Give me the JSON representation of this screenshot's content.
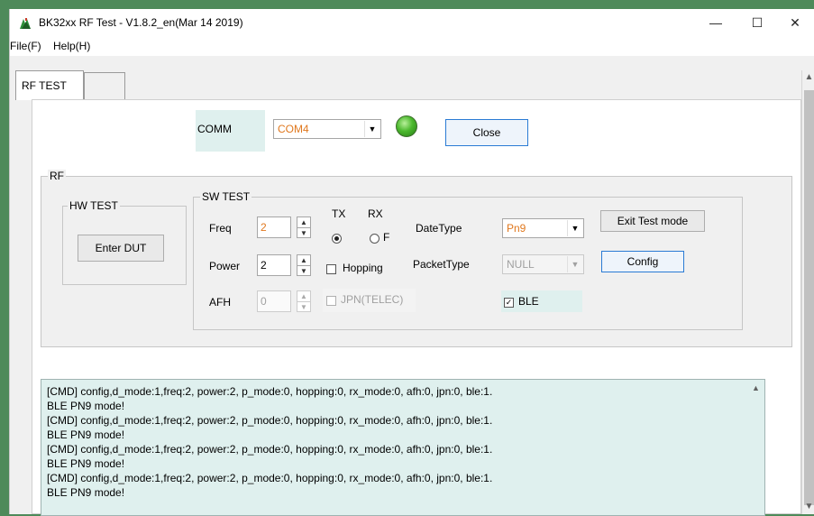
{
  "window": {
    "title": "BK32xx RF Test - V1.8.2_en(Mar 14 2019)",
    "minimize": "—",
    "maximize": "☐",
    "close": "✕"
  },
  "menu": {
    "file": "File(F)",
    "help": "Help(H)"
  },
  "tabs": [
    {
      "label": "RF TEST"
    },
    {
      "label": ""
    }
  ],
  "comm": {
    "label": "COMM",
    "value": "COM4",
    "close_button": "Close"
  },
  "rf": {
    "group_label": "RF",
    "hw_test": {
      "label": "HW TEST",
      "button": "Enter DUT"
    },
    "sw_test": {
      "label": "SW TEST",
      "freq_label": "Freq",
      "freq_value": "2",
      "power_label": "Power",
      "power_value": "2",
      "afh_label": "AFH",
      "afh_value": "0",
      "tx_label": "TX",
      "rx_label": "RX",
      "rx_radio_text": "F",
      "hopping_label": "Hopping",
      "jpn_label": "JPN(TELEC)",
      "datetype_label": "DateType",
      "datetype_value": "Pn9",
      "packettype_label": "PacketType",
      "packettype_value": "NULL",
      "ble_label": "BLE",
      "exit_button": "Exit Test mode",
      "config_button": "Config"
    }
  },
  "log": {
    "lines": [
      "[CMD] config,d_mode:1,freq:2, power:2, p_mode:0, hopping:0, rx_mode:0, afh:0, jpn:0, ble:1.",
      "BLE PN9 mode!",
      "[CMD] config,d_mode:1,freq:2, power:2, p_mode:0, hopping:0, rx_mode:0, afh:0, jpn:0, ble:1.",
      "BLE PN9 mode!",
      "[CMD] config,d_mode:1,freq:2, power:2, p_mode:0, hopping:0, rx_mode:0, afh:0, jpn:0, ble:1.",
      "BLE PN9 mode!",
      "[CMD] config,d_mode:1,freq:2, power:2, p_mode:0, hopping:0, rx_mode:0, afh:0, jpn:0, ble:1.",
      "BLE PN9 mode!"
    ]
  },
  "icons": {
    "app": "app-icon",
    "dropdown": "chevron-down-icon",
    "scroll_up": "chevron-up-icon",
    "scroll_down": "chevron-down-icon",
    "spin_up": "spin-up-icon",
    "spin_down": "spin-down-icon",
    "check": "checkmark-icon"
  },
  "colors": {
    "comm_value": "#e0781e",
    "datetype_value": "#e0781e",
    "log_bg": "#dff0ee",
    "led": "#4cb92e",
    "focus_border": "#2a7bd4"
  }
}
